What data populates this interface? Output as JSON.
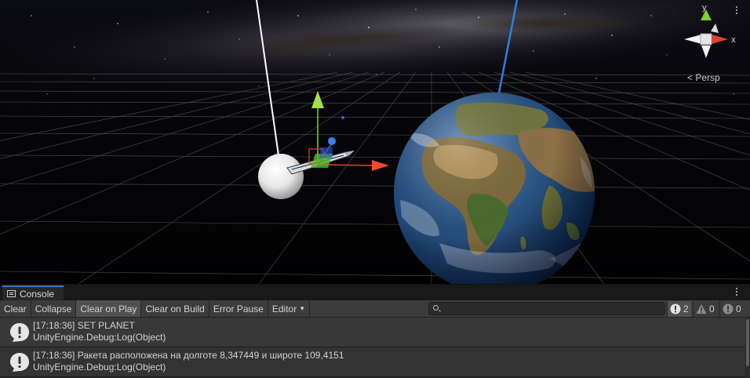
{
  "scene": {
    "gizmo": {
      "y_label": "y",
      "x_label": "x",
      "projection_label": "< Persp"
    }
  },
  "console": {
    "tab_label": "Console",
    "toolbar": {
      "clear": "Clear",
      "collapse": "Collapse",
      "clear_on_play": "Clear on Play",
      "clear_on_build": "Clear on Build",
      "error_pause": "Error Pause",
      "editor": "Editor",
      "search_placeholder": ""
    },
    "counters": {
      "info": "2",
      "warnings": "0",
      "errors": "0"
    },
    "logs": [
      {
        "line1": "[17:18:36] SET PLANET",
        "line2": "UnityEngine.Debug:Log(Object)"
      },
      {
        "line1": "[17:18:36] Ракета расположена на долготе 8,347449 и широте 109,4151",
        "line2": "UnityEngine.Debug:Log(Object)"
      }
    ]
  },
  "colors": {
    "x_axis": "#e2412c",
    "y_axis": "#83cb2f",
    "z_axis": "#3a72f5",
    "console_bg": "#282828",
    "toolbar_bg": "#3c3c3c",
    "tab_accent": "#3a72c9"
  }
}
